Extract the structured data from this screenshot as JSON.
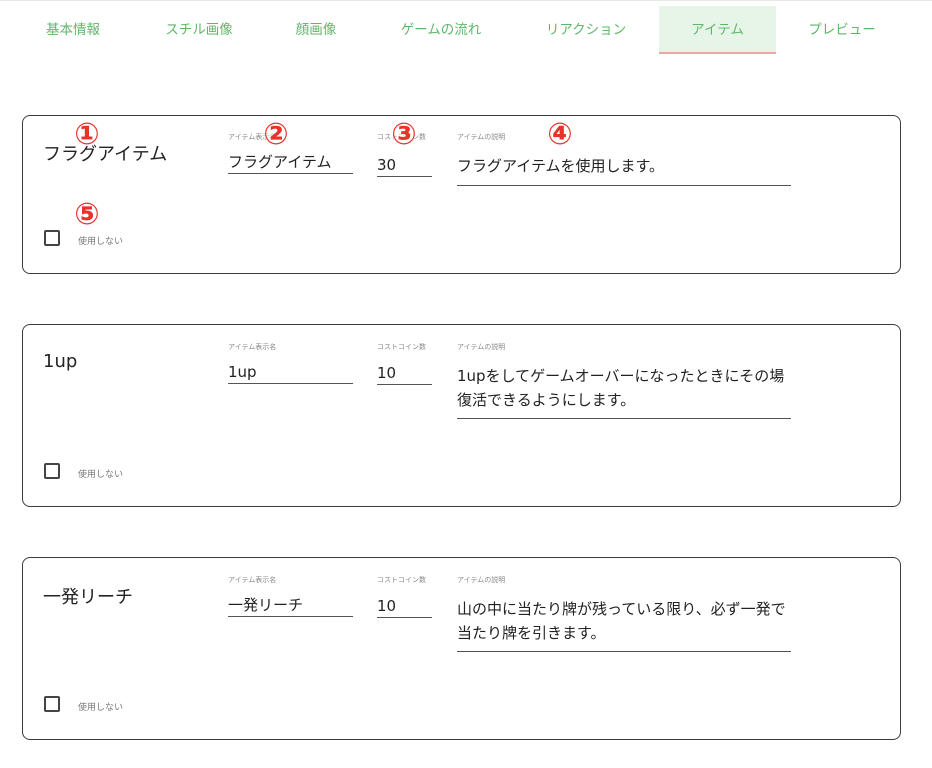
{
  "tabs": [
    {
      "label": "基本情報"
    },
    {
      "label": "スチル画像"
    },
    {
      "label": "顔画像"
    },
    {
      "label": "ゲームの流れ"
    },
    {
      "label": "リアクション"
    },
    {
      "label": "アイテム",
      "active": true
    },
    {
      "label": "プレビュー"
    }
  ],
  "field_labels": {
    "display_name": "アイテム表示名",
    "cost": "コストコイン数",
    "description": "アイテムの説明",
    "unused": "使用しない"
  },
  "items": [
    {
      "title": "フラグアイテム",
      "display_name": "フラグアイテム",
      "cost": "30",
      "description": "フラグアイテムを使用します。",
      "unused": false
    },
    {
      "title": "1up",
      "display_name": "1up",
      "cost": "10",
      "description": "1upをしてゲームオーバーになったときにその場復活できるようにします。",
      "unused": false
    },
    {
      "title": "一発リーチ",
      "display_name": "一発リーチ",
      "cost": "10",
      "description": "山の中に当たり牌が残っている限り、必ず一発で当たり牌を引きます。",
      "unused": false
    }
  ],
  "markers": [
    "①",
    "②",
    "③",
    "④",
    "⑤"
  ],
  "colors": {
    "tab_text": "#5fb66a",
    "tab_active_bg": "#e7f5e8",
    "tab_active_underline": "#f2a3a3",
    "marker": "#e8322a"
  }
}
